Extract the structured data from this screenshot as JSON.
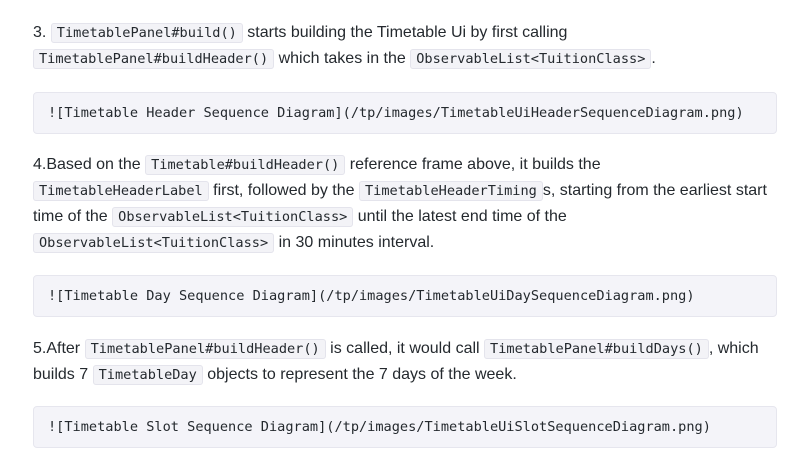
{
  "para3": {
    "t1": "3. ",
    "c1": "TimetablePanel#build()",
    "t2": " starts building the Timetable Ui by first calling ",
    "c2": "TimetablePanel#buildHeader()",
    "t3": " which takes in the ",
    "c3": "ObservableList<TuitionClass>",
    "t4": "."
  },
  "block1": "![Timetable Header Sequence Diagram](/tp/images/TimetableUiHeaderSequenceDiagram.png)",
  "para4": {
    "t1": "4.Based on the ",
    "c1": "Timetable#buildHeader()",
    "t2": " reference frame above, it builds the ",
    "c2": "TimetableHeaderLabel",
    "t3": " first, followed by the ",
    "c3": "TimetableHeaderTiming",
    "t4": "s, starting from the earliest start time of the ",
    "c4": "ObservableList<TuitionClass>",
    "t5": " until the latest end time of the ",
    "c5": "ObservableList<TuitionClass>",
    "t6": " in 30 minutes interval."
  },
  "block2": "![Timetable Day Sequence Diagram](/tp/images/TimetableUiDaySequenceDiagram.png)",
  "para5": {
    "t1": "5.After ",
    "c1": "TimetablePanel#buildHeader()",
    "t2": " is called, it would call ",
    "c2": "TimetablePanel#buildDays()",
    "t3": ", which builds 7 ",
    "c3": "TimetableDay",
    "t4": " objects to represent the 7 days of the week."
  },
  "block3": "![Timetable Slot Sequence Diagram](/tp/images/TimetableUiSlotSequenceDiagram.png)"
}
